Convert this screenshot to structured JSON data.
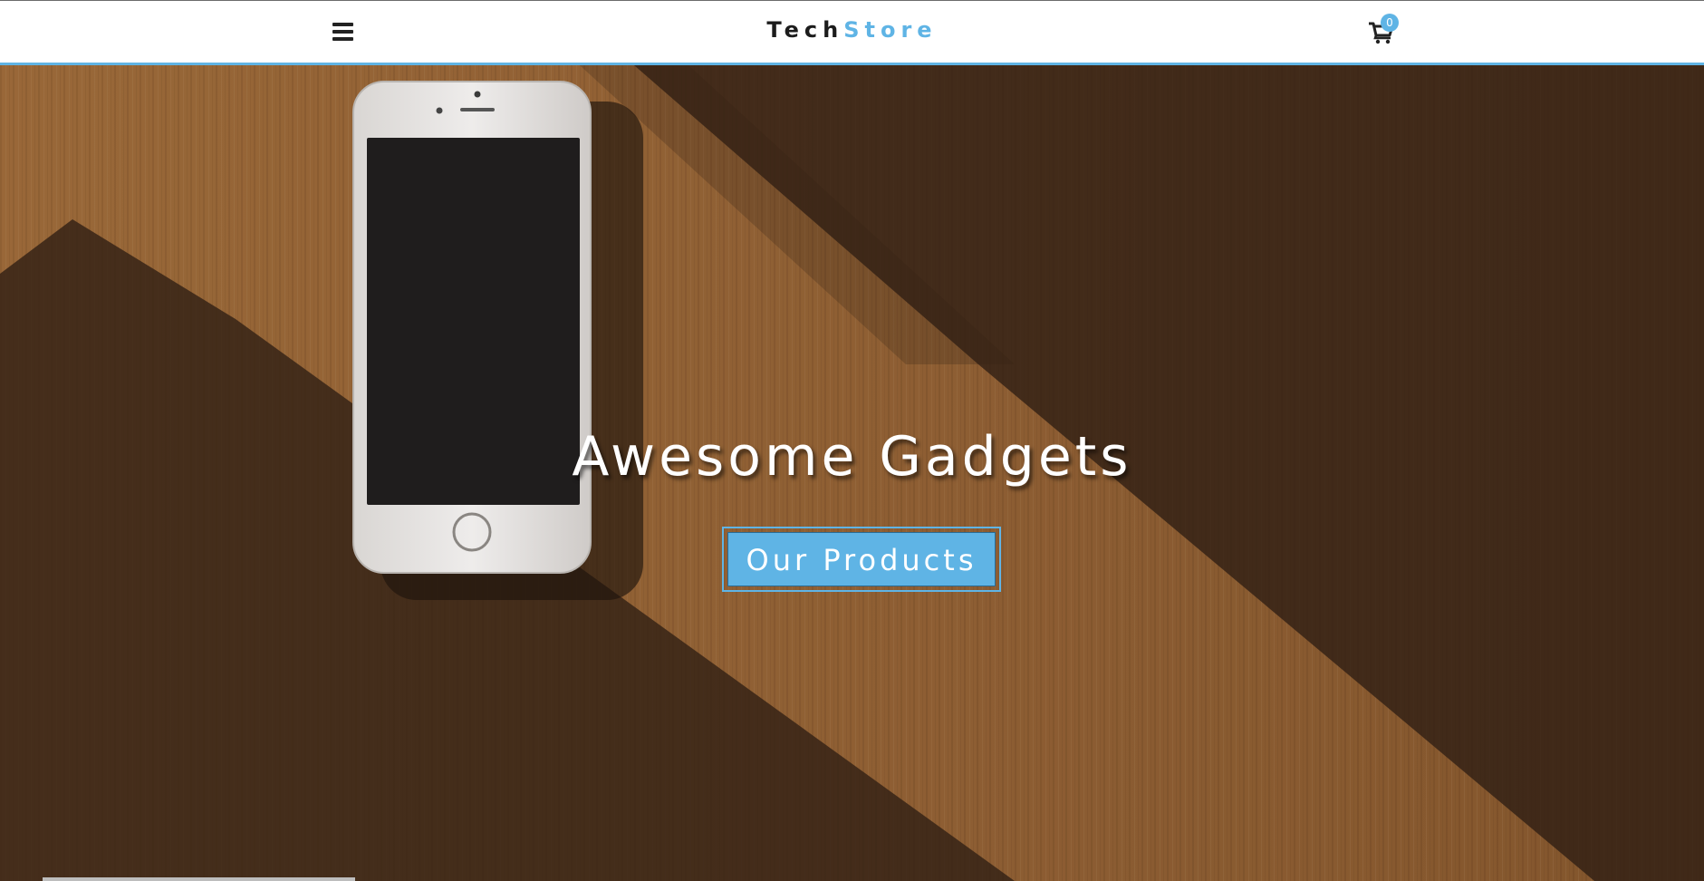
{
  "navbar": {
    "menu_icon": "hamburger-menu-icon",
    "logo_part1": "Tech",
    "logo_part2": "Store",
    "cart_icon": "shopping-cart-icon",
    "cart_count": "0"
  },
  "hero": {
    "title": "Awesome Gadgets",
    "button_label": "Our Products",
    "image": "smartphone-on-wooden-table"
  },
  "colors": {
    "accent": "#5fb4e5",
    "logo_dark": "#1c1c1c",
    "wood": "#a56d3a",
    "shadow": "#3a2618"
  }
}
